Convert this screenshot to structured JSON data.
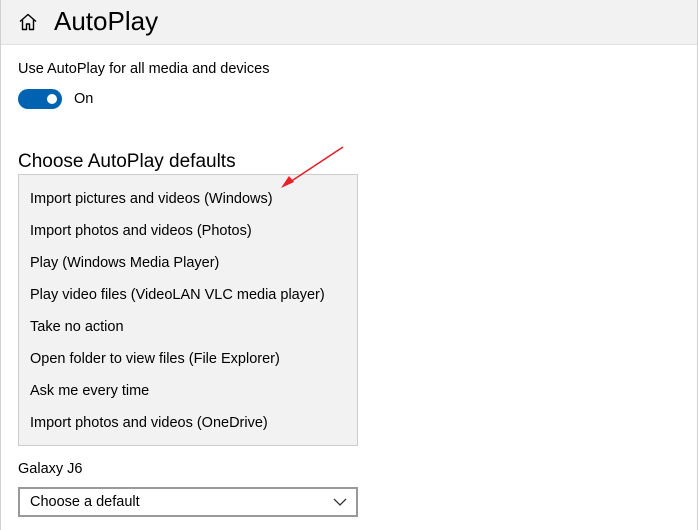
{
  "header": {
    "home_icon": "home-icon",
    "title": "AutoPlay"
  },
  "autoplay_setting": {
    "label": "Use AutoPlay for all media and devices",
    "toggle_state": "On",
    "toggle_on": true,
    "accent_color": "#0063b1"
  },
  "defaults_section": {
    "heading": "Choose AutoPlay defaults",
    "options": [
      "Import pictures and videos (Windows)",
      "Import photos and videos (Photos)",
      "Play (Windows Media Player)",
      "Play video files (VideoLAN VLC media player)",
      "Take no action",
      "Open folder to view files (File Explorer)",
      "Ask me every time",
      "Import photos and videos (OneDrive)"
    ]
  },
  "device": {
    "label": "Galaxy J6",
    "selected": "Choose a default",
    "chevron_icon": "chevron-down-icon"
  },
  "annotation": {
    "arrow_color": "#e8202a"
  }
}
